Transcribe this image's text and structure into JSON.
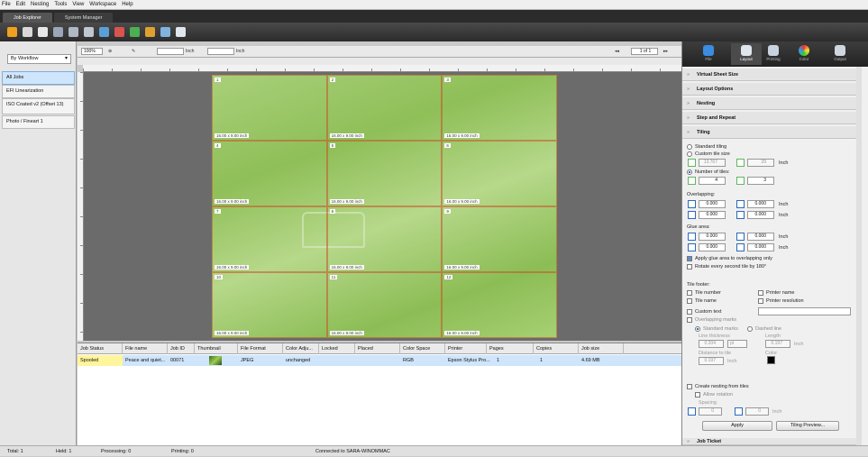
{
  "menu": [
    "File",
    "Edit",
    "Nesting",
    "Tools",
    "View",
    "Workspace",
    "Help"
  ],
  "app_tabs": [
    "Job Explorer",
    "System Manager"
  ],
  "toolbar_icons": [
    "open-folder-icon",
    "folder-icon",
    "list-icon",
    "printer-icon",
    "print-queue-icon",
    "print-icon",
    "layout-icon",
    "image-icon",
    "green-doc-icon",
    "color-icon",
    "doc-icon",
    "doc-blue-icon"
  ],
  "left": {
    "workflow": "By Workflow",
    "queues": [
      "All Jobs",
      "EFI Linearization",
      "ISO Coated v2 (Offset 13)",
      "Photo / Fineart 1"
    ]
  },
  "viewbar": {
    "zoom": "100%",
    "unit1": "Inch",
    "unit2": "Inch",
    "page": "1 of 1"
  },
  "tiles": [
    {
      "n": "1",
      "size": "16.00 x 9.00 inch"
    },
    {
      "n": "2",
      "size": "16.00 x 9.00 inch"
    },
    {
      "n": "3",
      "size": "16.00 x 9.00 inch"
    },
    {
      "n": "4",
      "size": "16.00 x 9.00 inch"
    },
    {
      "n": "5",
      "size": "16.00 x 9.00 inch"
    },
    {
      "n": "6",
      "size": "16.00 x 9.00 inch"
    },
    {
      "n": "7",
      "size": "16.00 x 9.00 inch"
    },
    {
      "n": "8",
      "size": "16.00 x 9.00 inch"
    },
    {
      "n": "9",
      "size": "16.00 x 9.00 inch"
    },
    {
      "n": "10",
      "size": "16.00 x 9.00 inch"
    },
    {
      "n": "11",
      "size": "16.00 x 9.00 inch"
    },
    {
      "n": "12",
      "size": "16.00 x 9.00 inch"
    }
  ],
  "jobs": {
    "columns": [
      "Job Status",
      "File name",
      "Job ID",
      "Thumbnail",
      "File Format",
      "Color Adju...",
      "Locked",
      "Placed",
      "Color Space",
      "Printer",
      "Pages",
      "Copies",
      "Job size"
    ],
    "row": {
      "status": "Spooled",
      "file": "Peace and quiet...",
      "id": "00071",
      "format": "JPEG",
      "color_adj": "unchanged",
      "color_space": "RGB",
      "printer": "Epson Stylus Pro...",
      "pages": "1",
      "copies": "1",
      "size": "4.69 MB"
    }
  },
  "status": {
    "total": "Total: 1",
    "held": "Held: 1",
    "processing": "Processing: 0",
    "printing": "Printing: 0",
    "connected": "Connected to SARA-WINOMMAC"
  },
  "right": {
    "tabs": [
      "File",
      "Layout",
      "Printing",
      "Color",
      "Output"
    ],
    "sections": [
      "Virtual Sheet Size",
      "Layout Options",
      "Nesting",
      "Step and Repeat",
      "Tiling"
    ],
    "tiling": {
      "standard": "Standard tiling",
      "custom": "Custom tile size",
      "custom_w": "13.767",
      "custom_h": "29",
      "inch": "Inch",
      "number": "Number of tiles:",
      "cols": "4",
      "rows": "3",
      "overlapping": "Overlapping:",
      "glue": "Glue area:",
      "zero": "0.000",
      "apply_glue": "Apply glue area to overlapping only",
      "rotate": "Rotate every second tile by 180°",
      "footer": "Tile footer:",
      "tile_number": "Tile number",
      "tile_name": "Tile name",
      "printer_name": "Printer name",
      "printer_res": "Printer resolution",
      "custom_text": "Custom text",
      "overlap_marks": "Overlapping marks",
      "standard_marks": "Standard marks",
      "dashed": "Dashed line",
      "line_thickness": "Line thickness",
      "length": "Length",
      "thick_val": "0.204",
      "pt": "pt",
      "len_val": "0.197",
      "dist": "Distance to tile",
      "color": "Color",
      "dist_val": "0.197",
      "create_nesting": "Create nesting from tiles",
      "allow_rot": "Allow rotation",
      "spacing": "Spacing",
      "sp1": "0",
      "sp2": "0",
      "apply": "Apply",
      "preview": "Tiling Preview..."
    },
    "job_ticket": "Job Ticket"
  }
}
